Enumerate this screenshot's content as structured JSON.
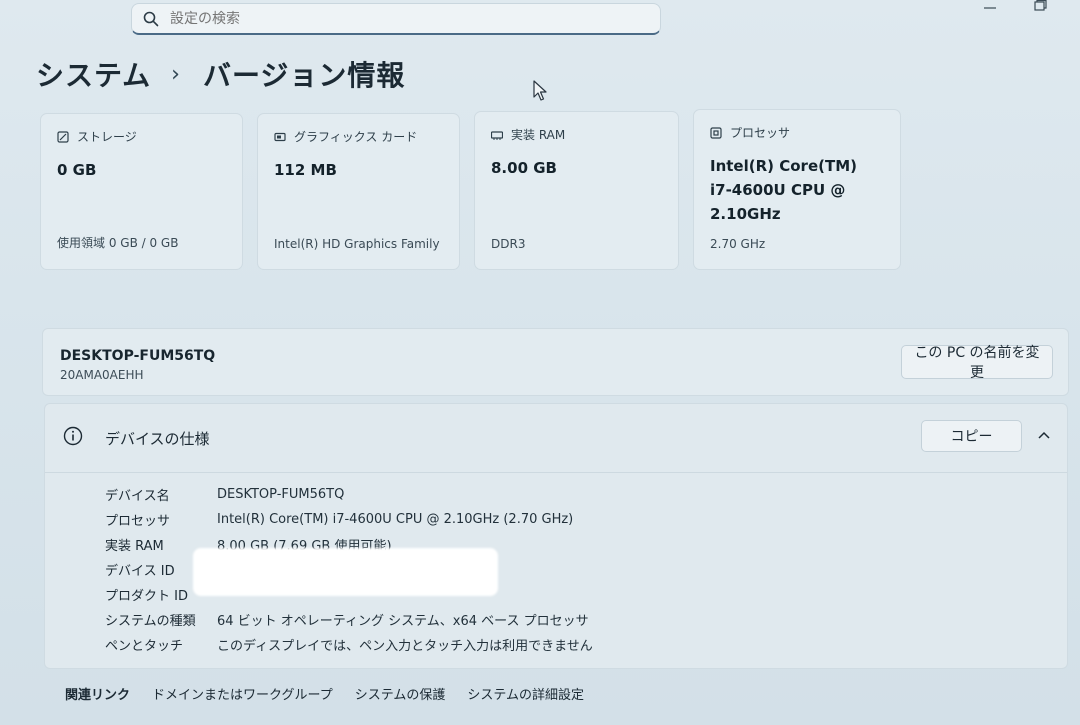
{
  "search": {
    "placeholder": "設定の検索"
  },
  "breadcrumb": {
    "parent": "システム",
    "separator": "›",
    "current": "バージョン情報"
  },
  "cards": [
    {
      "icon": "storage-icon",
      "title": "ストレージ",
      "value": "0 GB",
      "sub": "使用領域 0 GB / 0 GB"
    },
    {
      "icon": "graphics-card-icon",
      "title": "グラフィックス カード",
      "value": "112 MB",
      "sub": "Intel(R) HD Graphics Family"
    },
    {
      "icon": "ram-icon",
      "title": "実装 RAM",
      "value": "8.00 GB",
      "sub": "DDR3"
    },
    {
      "icon": "processor-icon",
      "title": "プロセッサ",
      "value": "Intel(R) Core(TM) i7-4600U CPU @ 2.10GHz",
      "sub": "2.70 GHz"
    }
  ],
  "device": {
    "name": "DESKTOP-FUM56TQ",
    "model": "20AMA0AEHH",
    "rename_label": "この PC の名前を変更"
  },
  "spec": {
    "title": "デバイスの仕様",
    "copy_label": "コピー",
    "rows": [
      {
        "key": "デバイス名",
        "value": "DESKTOP-FUM56TQ"
      },
      {
        "key": "プロセッサ",
        "value": "Intel(R) Core(TM) i7-4600U CPU @ 2.10GHz (2.70 GHz)"
      },
      {
        "key": "実装 RAM",
        "value": "8.00 GB (7.69 GB 使用可能)"
      },
      {
        "key": "デバイス ID",
        "value": ""
      },
      {
        "key": "プロダクト ID",
        "value": ""
      },
      {
        "key": "システムの種類",
        "value": "64 ビット オペレーティング システム、x64 ベース プロセッサ"
      },
      {
        "key": "ペンとタッチ",
        "value": "このディスプレイでは、ペン入力とタッチ入力は利用できません"
      }
    ]
  },
  "related": {
    "label": "関連リンク",
    "links": [
      "ドメインまたはワークグループ",
      "システムの保護",
      "システムの詳細設定"
    ]
  }
}
